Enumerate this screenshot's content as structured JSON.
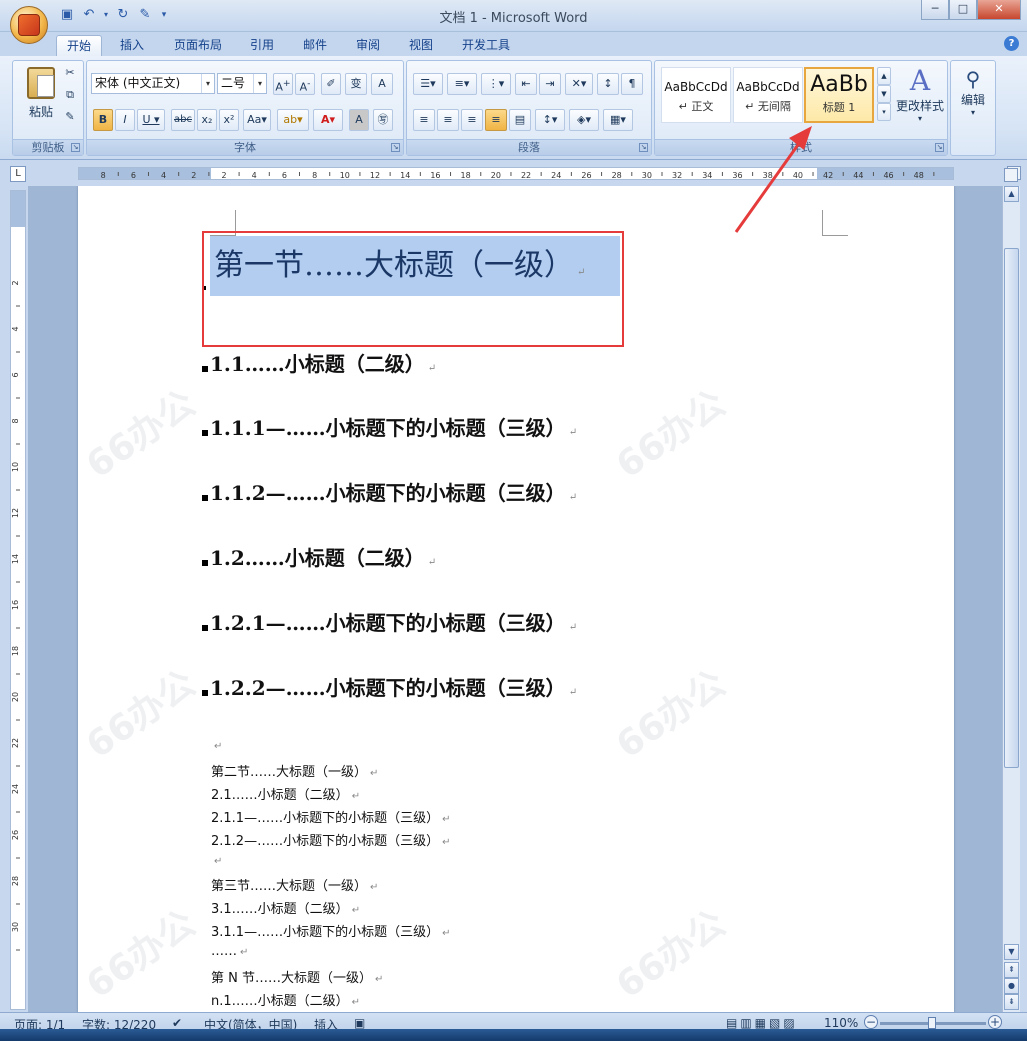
{
  "window": {
    "title": "文档 1 - Microsoft Word"
  },
  "tabs": [
    {
      "label": "开始",
      "active": true
    },
    {
      "label": "插入"
    },
    {
      "label": "页面布局"
    },
    {
      "label": "引用"
    },
    {
      "label": "邮件"
    },
    {
      "label": "审阅"
    },
    {
      "label": "视图"
    },
    {
      "label": "开发工具"
    }
  ],
  "ribbon": {
    "clipboard": {
      "label": "剪贴板",
      "paste": "粘贴"
    },
    "font": {
      "label": "字体",
      "font_name": "宋体 (中文正文)",
      "font_size": "二号"
    },
    "paragraph": {
      "label": "段落"
    },
    "styles": {
      "label": "样式",
      "items": [
        {
          "sample": "AaBbCcDd",
          "name": "↵ 正文"
        },
        {
          "sample": "AaBbCcDd",
          "name": "↵ 无间隔"
        },
        {
          "sample": "AaBb",
          "name": "标题 1",
          "selected": true
        }
      ],
      "change_styles": "更改样式"
    },
    "editing": {
      "label": "编辑"
    }
  },
  "document": {
    "heading1": "第一节……大标题（一级）",
    "headings": [
      {
        "level": 2,
        "text": "1.1……小标题（二级）"
      },
      {
        "level": 3,
        "text": "1.1.1—……小标题下的小标题（三级）"
      },
      {
        "level": 3,
        "text": "1.1.2—……小标题下的小标题（三级）"
      },
      {
        "level": 2,
        "text": "1.2……小标题（二级）"
      },
      {
        "level": 3,
        "text": "1.2.1—……小标题下的小标题（三级）"
      },
      {
        "level": 3,
        "text": "1.2.2—……小标题下的小标题（三级）"
      }
    ],
    "body_lines": [
      "",
      "第二节……大标题（一级）",
      "2.1……小标题（二级）",
      "2.1.1—……小标题下的小标题（三级）",
      "2.1.2—……小标题下的小标题（三级）",
      "",
      "第三节……大标题（一级）",
      "3.1……小标题（二级）",
      "3.1.1—……小标题下的小标题（三级）",
      "……",
      "第 N 节……大标题（一级）",
      "n.1……小标题（二级）"
    ],
    "paragraph_mark": "↵"
  },
  "ruler": {
    "labels": [
      "8",
      "6",
      "4",
      "2",
      "2",
      "4",
      "6",
      "8",
      "10",
      "12",
      "14",
      "16",
      "18",
      "20",
      "22",
      "24",
      "26",
      "28",
      "30",
      "32",
      "34",
      "36",
      "38",
      "40",
      "42",
      "44",
      "46",
      "48"
    ]
  },
  "vruler": {
    "labels": [
      "2",
      "4",
      "6",
      "8",
      "10",
      "12",
      "14",
      "16",
      "18",
      "20",
      "22",
      "24",
      "26",
      "28",
      "30"
    ]
  },
  "status": {
    "page": "页面: 1/1",
    "words": "字数: 12/220",
    "language": "中文(简体，中国)",
    "insert_mode": "插入",
    "zoom": "110%"
  },
  "watermark": "66办公"
}
